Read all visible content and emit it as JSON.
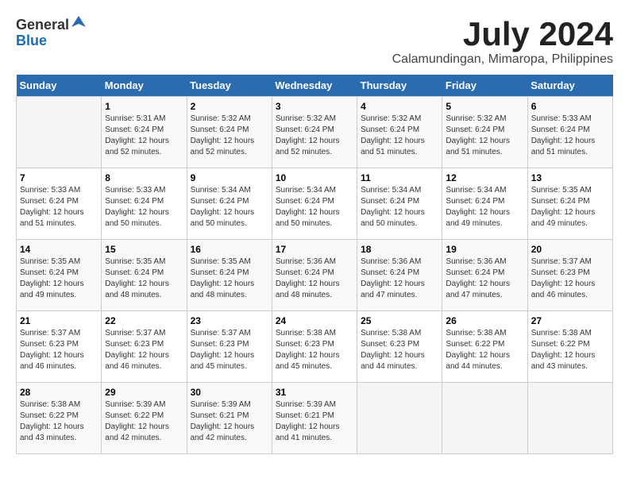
{
  "header": {
    "logo_line1": "General",
    "logo_line2": "Blue",
    "month": "July 2024",
    "location": "Calamundingan, Mimaropa, Philippines"
  },
  "weekdays": [
    "Sunday",
    "Monday",
    "Tuesday",
    "Wednesday",
    "Thursday",
    "Friday",
    "Saturday"
  ],
  "weeks": [
    [
      {
        "day": "",
        "info": ""
      },
      {
        "day": "1",
        "info": "Sunrise: 5:31 AM\nSunset: 6:24 PM\nDaylight: 12 hours\nand 52 minutes."
      },
      {
        "day": "2",
        "info": "Sunrise: 5:32 AM\nSunset: 6:24 PM\nDaylight: 12 hours\nand 52 minutes."
      },
      {
        "day": "3",
        "info": "Sunrise: 5:32 AM\nSunset: 6:24 PM\nDaylight: 12 hours\nand 52 minutes."
      },
      {
        "day": "4",
        "info": "Sunrise: 5:32 AM\nSunset: 6:24 PM\nDaylight: 12 hours\nand 51 minutes."
      },
      {
        "day": "5",
        "info": "Sunrise: 5:32 AM\nSunset: 6:24 PM\nDaylight: 12 hours\nand 51 minutes."
      },
      {
        "day": "6",
        "info": "Sunrise: 5:33 AM\nSunset: 6:24 PM\nDaylight: 12 hours\nand 51 minutes."
      }
    ],
    [
      {
        "day": "7",
        "info": "Sunrise: 5:33 AM\nSunset: 6:24 PM\nDaylight: 12 hours\nand 51 minutes."
      },
      {
        "day": "8",
        "info": "Sunrise: 5:33 AM\nSunset: 6:24 PM\nDaylight: 12 hours\nand 50 minutes."
      },
      {
        "day": "9",
        "info": "Sunrise: 5:34 AM\nSunset: 6:24 PM\nDaylight: 12 hours\nand 50 minutes."
      },
      {
        "day": "10",
        "info": "Sunrise: 5:34 AM\nSunset: 6:24 PM\nDaylight: 12 hours\nand 50 minutes."
      },
      {
        "day": "11",
        "info": "Sunrise: 5:34 AM\nSunset: 6:24 PM\nDaylight: 12 hours\nand 50 minutes."
      },
      {
        "day": "12",
        "info": "Sunrise: 5:34 AM\nSunset: 6:24 PM\nDaylight: 12 hours\nand 49 minutes."
      },
      {
        "day": "13",
        "info": "Sunrise: 5:35 AM\nSunset: 6:24 PM\nDaylight: 12 hours\nand 49 minutes."
      }
    ],
    [
      {
        "day": "14",
        "info": "Sunrise: 5:35 AM\nSunset: 6:24 PM\nDaylight: 12 hours\nand 49 minutes."
      },
      {
        "day": "15",
        "info": "Sunrise: 5:35 AM\nSunset: 6:24 PM\nDaylight: 12 hours\nand 48 minutes."
      },
      {
        "day": "16",
        "info": "Sunrise: 5:35 AM\nSunset: 6:24 PM\nDaylight: 12 hours\nand 48 minutes."
      },
      {
        "day": "17",
        "info": "Sunrise: 5:36 AM\nSunset: 6:24 PM\nDaylight: 12 hours\nand 48 minutes."
      },
      {
        "day": "18",
        "info": "Sunrise: 5:36 AM\nSunset: 6:24 PM\nDaylight: 12 hours\nand 47 minutes."
      },
      {
        "day": "19",
        "info": "Sunrise: 5:36 AM\nSunset: 6:24 PM\nDaylight: 12 hours\nand 47 minutes."
      },
      {
        "day": "20",
        "info": "Sunrise: 5:37 AM\nSunset: 6:23 PM\nDaylight: 12 hours\nand 46 minutes."
      }
    ],
    [
      {
        "day": "21",
        "info": "Sunrise: 5:37 AM\nSunset: 6:23 PM\nDaylight: 12 hours\nand 46 minutes."
      },
      {
        "day": "22",
        "info": "Sunrise: 5:37 AM\nSunset: 6:23 PM\nDaylight: 12 hours\nand 46 minutes."
      },
      {
        "day": "23",
        "info": "Sunrise: 5:37 AM\nSunset: 6:23 PM\nDaylight: 12 hours\nand 45 minutes."
      },
      {
        "day": "24",
        "info": "Sunrise: 5:38 AM\nSunset: 6:23 PM\nDaylight: 12 hours\nand 45 minutes."
      },
      {
        "day": "25",
        "info": "Sunrise: 5:38 AM\nSunset: 6:23 PM\nDaylight: 12 hours\nand 44 minutes."
      },
      {
        "day": "26",
        "info": "Sunrise: 5:38 AM\nSunset: 6:22 PM\nDaylight: 12 hours\nand 44 minutes."
      },
      {
        "day": "27",
        "info": "Sunrise: 5:38 AM\nSunset: 6:22 PM\nDaylight: 12 hours\nand 43 minutes."
      }
    ],
    [
      {
        "day": "28",
        "info": "Sunrise: 5:38 AM\nSunset: 6:22 PM\nDaylight: 12 hours\nand 43 minutes."
      },
      {
        "day": "29",
        "info": "Sunrise: 5:39 AM\nSunset: 6:22 PM\nDaylight: 12 hours\nand 42 minutes."
      },
      {
        "day": "30",
        "info": "Sunrise: 5:39 AM\nSunset: 6:21 PM\nDaylight: 12 hours\nand 42 minutes."
      },
      {
        "day": "31",
        "info": "Sunrise: 5:39 AM\nSunset: 6:21 PM\nDaylight: 12 hours\nand 41 minutes."
      },
      {
        "day": "",
        "info": ""
      },
      {
        "day": "",
        "info": ""
      },
      {
        "day": "",
        "info": ""
      }
    ]
  ]
}
